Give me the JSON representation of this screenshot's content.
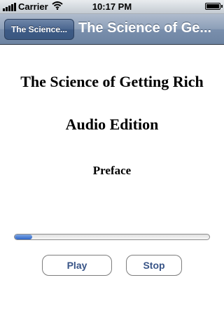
{
  "status_bar": {
    "carrier": "Carrier",
    "time": "10:17 PM",
    "battery_level": 1.0
  },
  "nav": {
    "back_label": "The Science...",
    "title": "The Science of Ge..."
  },
  "content": {
    "book_title": "The Science of Getting Rich",
    "edition": "Audio Edition",
    "chapter": "Preface",
    "progress_fraction": 0.09
  },
  "controls": {
    "play_label": "Play",
    "stop_label": "Stop"
  },
  "colors": {
    "nav_bar": "#6d84a2",
    "button_text": "#385487",
    "progress_fill": "#2d66c8"
  }
}
